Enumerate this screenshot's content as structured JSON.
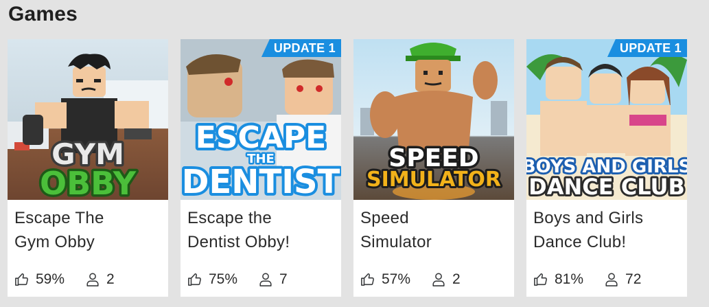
{
  "section": {
    "title": "Games"
  },
  "games": [
    {
      "name": "Escape The Gym Obby",
      "name_lines": [
        "Escape The",
        "Gym Obby"
      ],
      "thumb_text": [
        "GYM",
        "OBBY"
      ],
      "badge": "",
      "likes": "59%",
      "players": "2",
      "accent": "#4bbf3a"
    },
    {
      "name": "Escape the Dentist Obby!",
      "name_lines": [
        "Escape the",
        "Dentist Obby!"
      ],
      "thumb_text": [
        "ESCAPE",
        "THE",
        "DENTIST"
      ],
      "badge": "UPDATE 1",
      "likes": "75%",
      "players": "7",
      "accent": "#2fb7f0"
    },
    {
      "name": "Speed Simulator",
      "name_lines": [
        "Speed",
        "Simulator"
      ],
      "thumb_text": [
        "SPEED",
        "SIMULATOR"
      ],
      "badge": "",
      "likes": "57%",
      "players": "2",
      "accent": "#f2b21a"
    },
    {
      "name": "Boys and Girls Dance Club!",
      "name_lines": [
        "Boys and Girls",
        "Dance Club!"
      ],
      "thumb_text": [
        "BOYS AND GIRLS",
        "DANCE CLUB"
      ],
      "badge": "UPDATE 1",
      "likes": "81%",
      "players": "72",
      "accent": "#e0469a"
    }
  ],
  "icons": {
    "likes": "thumbs-up-icon",
    "players": "person-icon"
  }
}
